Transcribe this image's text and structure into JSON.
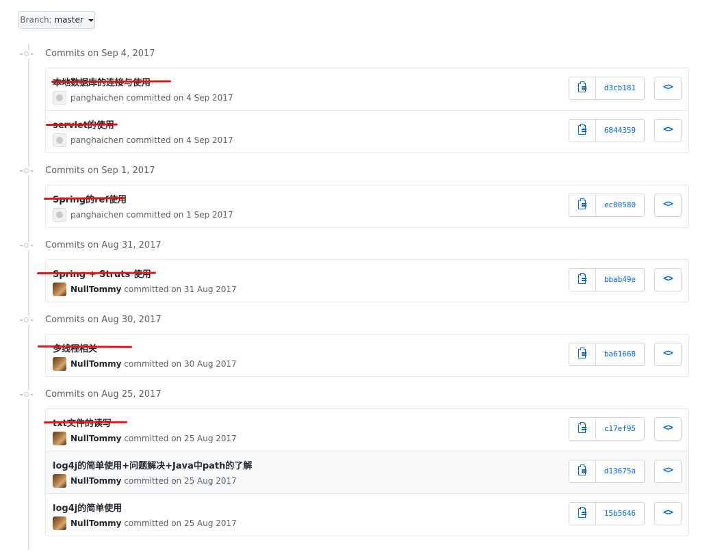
{
  "branch": {
    "label": "Branch:",
    "value": "master"
  },
  "groups": [
    {
      "header": "Commits on Sep 4, 2017",
      "commits": [
        {
          "message": "本地数据库的连接与使用",
          "author": "panghaichen",
          "meta": "committed on 4 Sep 2017",
          "sha": "d3cb181"
        },
        {
          "message": "servlet的使用",
          "author": "panghaichen",
          "meta": "committed on 4 Sep 2017",
          "sha": "6844359"
        }
      ]
    },
    {
      "header": "Commits on Sep 1, 2017",
      "commits": [
        {
          "message": "Spring的ref使用",
          "author": "panghaichen",
          "meta": "committed on 1 Sep 2017",
          "sha": "ec00580"
        }
      ]
    },
    {
      "header": "Commits on Aug 31, 2017",
      "commits": [
        {
          "message": "Spring + Struts 使用",
          "author": "NullTommy",
          "meta": "committed on 31 Aug 2017",
          "sha": "bbab49e"
        }
      ]
    },
    {
      "header": "Commits on Aug 30, 2017",
      "commits": [
        {
          "message": "多线程相关",
          "author": "NullTommy",
          "meta": "committed on 30 Aug 2017",
          "sha": "ba61668"
        }
      ]
    },
    {
      "header": "Commits on Aug 25, 2017",
      "commits": [
        {
          "message": "txt文件的读写",
          "author": "NullTommy",
          "meta": "committed on 25 Aug 2017",
          "sha": "c17ef95"
        },
        {
          "message": "log4j的简单使用+问题解决+Java中path的了解",
          "author": "NullTommy",
          "meta": "committed on 25 Aug 2017",
          "sha": "d13675a"
        },
        {
          "message": "log4j的简单使用",
          "author": "NullTommy",
          "meta": "committed on 25 Aug 2017",
          "sha": "15b5646"
        }
      ]
    }
  ],
  "browse_label": "<>",
  "colors": {
    "link": "#0366d6",
    "strike": "#e0141b",
    "timeline": "#e1e4e8"
  }
}
